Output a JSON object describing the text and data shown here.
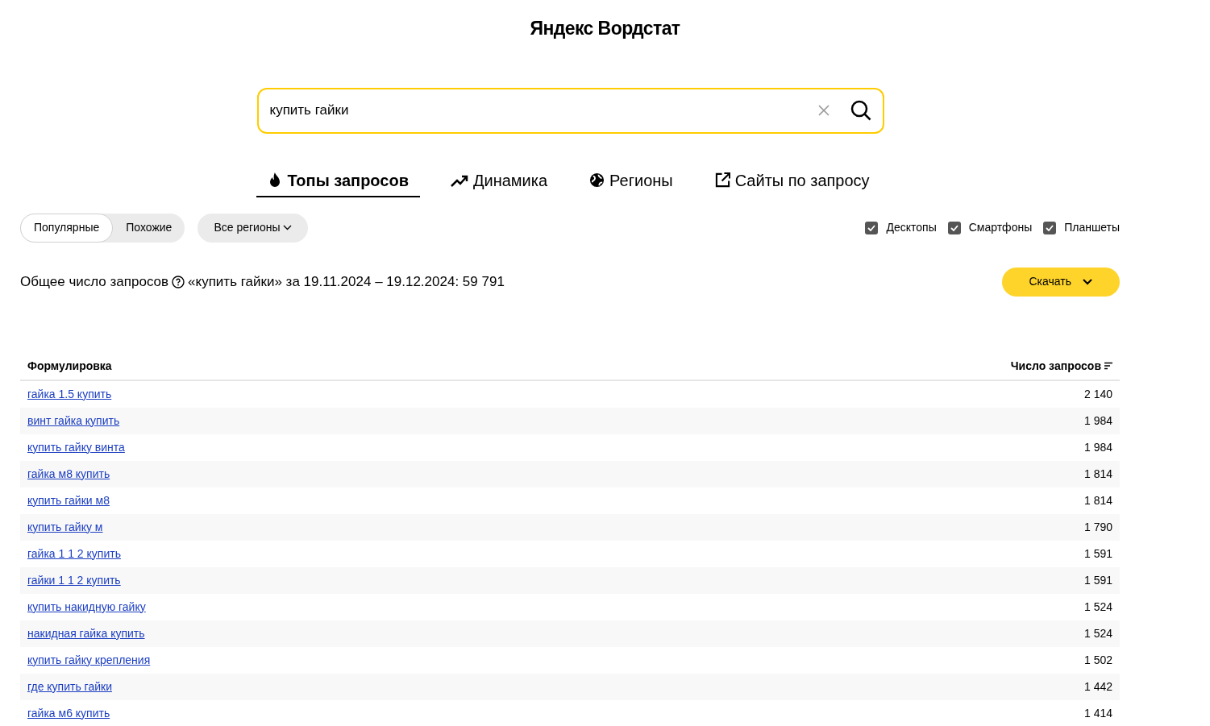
{
  "header": {
    "title": "Яндекс Вордстат"
  },
  "search": {
    "value": "купить гайки"
  },
  "tabs": [
    {
      "label": "Топы запросов",
      "selected": true
    },
    {
      "label": "Динамика",
      "selected": false
    },
    {
      "label": "Регионы",
      "selected": false
    },
    {
      "label": "Сайты по запросу",
      "selected": false
    }
  ],
  "modes": [
    {
      "label": "Популярные",
      "selected": true
    },
    {
      "label": "Похожие",
      "selected": false
    }
  ],
  "region_dropdown": {
    "label": "Все регионы"
  },
  "devices": [
    {
      "label": "Десктопы",
      "checked": true
    },
    {
      "label": "Смартфоны",
      "checked": true
    },
    {
      "label": "Планшеты",
      "checked": true
    }
  ],
  "summary": {
    "label": "Общее число запросов",
    "text": "«купить гайки» за 19.11.2024 – 19.12.2024: 59 791"
  },
  "download_button": {
    "label": "Скачать"
  },
  "table": {
    "columns": [
      "Формулировка",
      "Число запросов"
    ],
    "rows": [
      {
        "phrase": "гайка 1.5 купить",
        "count": "2 140"
      },
      {
        "phrase": "винт гайка купить",
        "count": "1 984"
      },
      {
        "phrase": "купить гайку винта",
        "count": "1 984"
      },
      {
        "phrase": "гайка м8 купить",
        "count": "1 814"
      },
      {
        "phrase": "купить гайки м8",
        "count": "1 814"
      },
      {
        "phrase": "купить гайку м",
        "count": "1 790"
      },
      {
        "phrase": "гайка 1 1 2 купить",
        "count": "1 591"
      },
      {
        "phrase": "гайки 1 1 2 купить",
        "count": "1 591"
      },
      {
        "phrase": "купить накидную гайку",
        "count": "1 524"
      },
      {
        "phrase": "накидная гайка купить",
        "count": "1 524"
      },
      {
        "phrase": "купить гайку крепления",
        "count": "1 502"
      },
      {
        "phrase": "где купить гайки",
        "count": "1 442"
      },
      {
        "phrase": "гайка м6 купить",
        "count": "1 414"
      }
    ]
  }
}
